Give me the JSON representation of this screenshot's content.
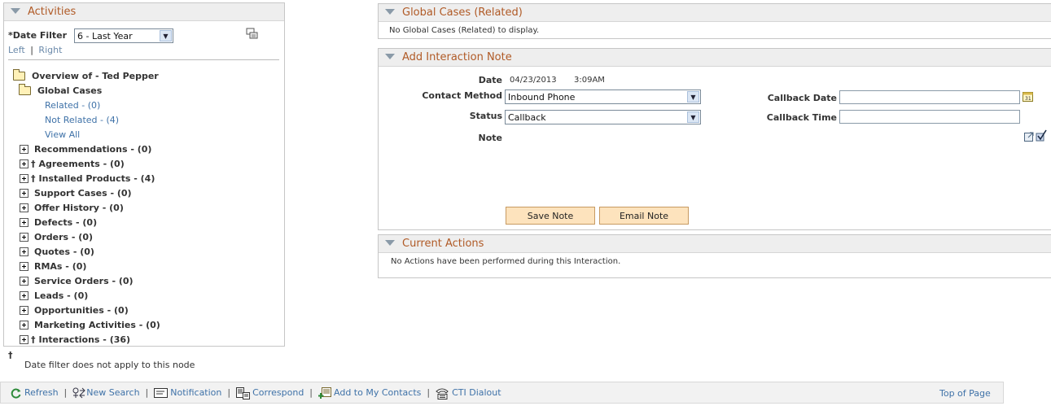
{
  "activities": {
    "title": "Activities",
    "date_filter_label": "*Date Filter",
    "date_filter_value": "6 - Last Year",
    "left_link": "Left",
    "separator": "|",
    "right_link": "Right",
    "overview_label": "Overview of - Ted Pepper",
    "global_cases_label": "Global Cases",
    "related_link": "Related - (0)",
    "not_related_link": "Not Related - (4)",
    "view_all_link": "View All",
    "nodes": [
      {
        "label": "Recommendations - (0)",
        "dagger": false
      },
      {
        "label": "Agreements - (0)",
        "dagger": true
      },
      {
        "label": "Installed Products - (4)",
        "dagger": true
      },
      {
        "label": "Support Cases - (0)",
        "dagger": false
      },
      {
        "label": "Offer History - (0)",
        "dagger": false
      },
      {
        "label": "Defects - (0)",
        "dagger": false
      },
      {
        "label": "Orders - (0)",
        "dagger": false
      },
      {
        "label": "Quotes - (0)",
        "dagger": false
      },
      {
        "label": "RMAs - (0)",
        "dagger": false
      },
      {
        "label": "Service Orders - (0)",
        "dagger": false
      },
      {
        "label": "Leads - (0)",
        "dagger": false
      },
      {
        "label": "Opportunities - (0)",
        "dagger": false
      },
      {
        "label": "Marketing Activities - (0)",
        "dagger": false
      },
      {
        "label": "Interactions - (36)",
        "dagger": true
      }
    ],
    "dagger_symbol": "†",
    "footnote": "Date filter does not apply to this node"
  },
  "global_cases": {
    "title": "Global Cases (Related)",
    "empty_text": "No Global Cases (Related) to display."
  },
  "interaction_note": {
    "title": "Add Interaction Note",
    "date_label": "Date",
    "date_value": "04/23/2013",
    "time_value": "3:09AM",
    "contact_method_label": "Contact Method",
    "contact_method_value": "Inbound Phone",
    "status_label": "Status",
    "status_value": "Callback",
    "note_label": "Note",
    "callback_date_label": "Callback Date",
    "callback_time_label": "Callback Time",
    "callback_date_value": "",
    "callback_time_value": "",
    "save_button": "Save Note",
    "email_button": "Email Note"
  },
  "current_actions": {
    "title": "Current Actions",
    "empty_text": "No Actions have been performed during this Interaction."
  },
  "toolbar": {
    "refresh": "Refresh",
    "new_search": "New Search",
    "notification": "Notification",
    "correspond": "Correspond",
    "add_contacts": "Add to My Contacts",
    "cti_dialout": "CTI Dialout",
    "top_of_page": "Top of Page",
    "separator": "|"
  },
  "colors": {
    "panel_title": "#b05a26",
    "link": "#3f72a8",
    "button_bg": "#fde3bd"
  }
}
